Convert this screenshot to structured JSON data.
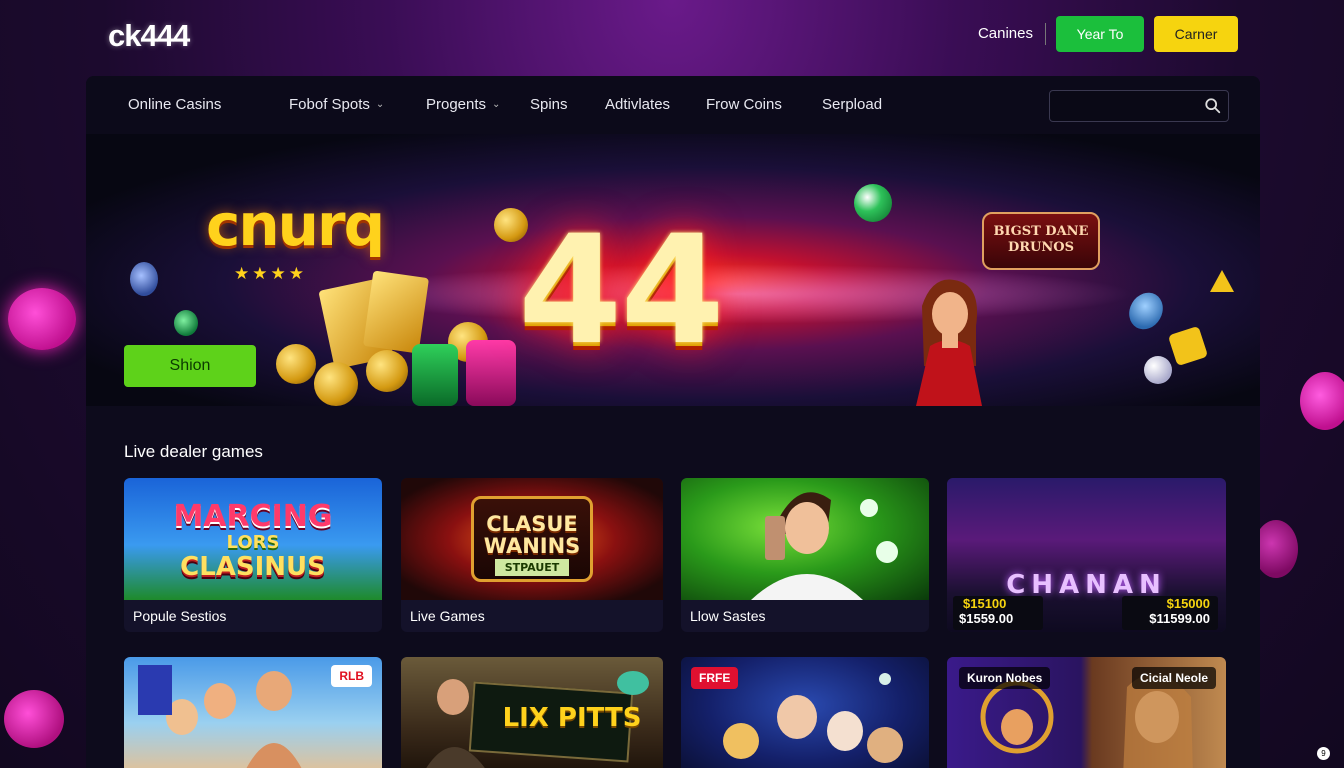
{
  "header": {
    "logo": "ck444",
    "link": "Canines",
    "button_green": "Year To",
    "button_yellow": "Carner"
  },
  "nav": {
    "items": [
      {
        "label": "Online Casins",
        "dropdown": false
      },
      {
        "label": "Fobof Spots",
        "dropdown": true
      },
      {
        "label": "Progents",
        "dropdown": true
      },
      {
        "label": "Spins",
        "dropdown": false
      },
      {
        "label": "Adtivlates",
        "dropdown": false
      },
      {
        "label": "Frow Coins",
        "dropdown": false
      },
      {
        "label": "Serpload",
        "dropdown": false
      }
    ],
    "search_placeholder": ""
  },
  "hero": {
    "brand": "cnurq",
    "stars": "★★★★",
    "big_number": "44",
    "cta": "Shion",
    "badge": "BIGST DANE DRUNOS"
  },
  "section": {
    "title": "Live dealer games"
  },
  "cards_row1": [
    {
      "art_text": [
        "MARCING",
        "LORS",
        "CLASINUS"
      ],
      "label": "Popule Sestios"
    },
    {
      "art_text": [
        "CLASUE",
        "WANINS",
        "STPAUET"
      ],
      "label": "Live Games"
    },
    {
      "art_text": [],
      "label": "Llow Sastes"
    },
    {
      "art_text": [
        "CHANAN"
      ],
      "label": "",
      "prices": [
        "$15100",
        "$1559.00",
        "$15000",
        "$11599.00"
      ]
    }
  ],
  "cards_row2": [
    {
      "tag": "RLB"
    },
    {
      "art_text": [
        "LIX PITTS"
      ]
    },
    {
      "tag": "FRFE"
    },
    {
      "tags": [
        "Kuron Nobes",
        "Cicial Neole"
      ]
    }
  ],
  "colors": {
    "accent_green": "#1bbf3c",
    "accent_yellow": "#f6d40f",
    "hero_cta": "#5ed21a",
    "panel_bg": "#0d0b1c"
  }
}
